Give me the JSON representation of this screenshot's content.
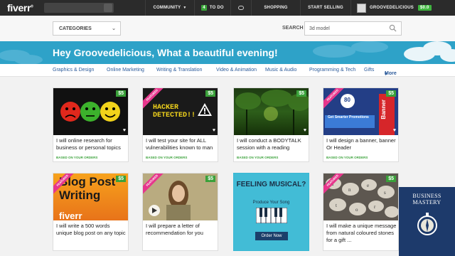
{
  "topbar": {
    "logo": "fiverr",
    "nav": {
      "community": "COMMUNITY",
      "todo_count": "4",
      "todo": "TO DO",
      "shopping": "SHOPPING",
      "start_selling": "START SELLING",
      "username": "GROOVEDELICIOUS",
      "balance": "$0.0"
    }
  },
  "subhead": {
    "categories": "CATEGORIES",
    "search_label": "SEARCH",
    "search_value": "3d model"
  },
  "banner": {
    "greeting": "Hey Groovedelicious, What a beautiful evening!"
  },
  "catnav": [
    "Graphics & Design",
    "Online Marketing",
    "Writing & Translation",
    "Video & Animation",
    "Music & Audio",
    "Programming & Tech",
    "Gifts",
    "More"
  ],
  "cards": [
    {
      "price": "$5",
      "title": "I will online research for business or personal topics",
      "based": "BASED ON YOUR ORDERS",
      "featured": ""
    },
    {
      "price": "$5",
      "title": "I will test your site for ALL vulnerabilities known to man",
      "based": "BASED ON YOUR ORDERS",
      "featured": "FEATURED",
      "image_text": "HACKER DETECTED!!"
    },
    {
      "price": "$5",
      "title": "I will conduct a BODYTALK session with a reading",
      "based": "BASED ON YOUR ORDERS",
      "featured": ""
    },
    {
      "price": "$5",
      "title": "I will design a banner, banner Or Header",
      "based": "BASED ON YOUR ORDERS",
      "featured": "FEATURED",
      "image_text": "Get Smarter Promotions",
      "image_sub": "Banner"
    },
    {
      "price": "$5",
      "title": "I will write a 500 words unique blog post on any topic",
      "based": "",
      "featured": "FEATURED",
      "image_text": "Blog Post Writing"
    },
    {
      "price": "$5",
      "title": "I will prepare a letter of recommendation for you",
      "based": "",
      "featured": "FEATURED"
    },
    {
      "price": "",
      "title": "",
      "based": "",
      "featured": "",
      "image_text": "FEELING MUSICAL?",
      "image_sub": "Produce Your Song",
      "image_btn": "Order Now"
    },
    {
      "price": "$5",
      "title": "I will make a unique message from natural coloured stones for a gift ...",
      "based": "",
      "featured": "FEATURED"
    }
  ],
  "watermark": {
    "line1": "BUSINESS",
    "line2": "MASTERY"
  }
}
